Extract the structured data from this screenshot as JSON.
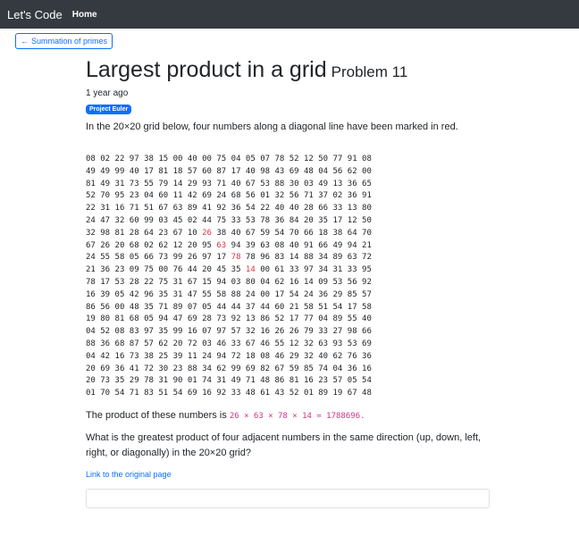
{
  "nav": {
    "brand": "Let's Code",
    "home": "Home"
  },
  "back_button": {
    "label": "Summation of primes",
    "icon": "arrow-left-icon"
  },
  "problem": {
    "title": "Largest product in a grid",
    "number": "Problem 11",
    "time_ago": "1 year ago",
    "badge": "Project Euler",
    "intro": "In the 20×20 grid below, four numbers along a diagonal line have been marked in red.",
    "grid_rows": [
      "08 02 22 97 38 15 00 40 00 75 04 05 07 78 52 12 50 77 91 08",
      "49 49 99 40 17 81 18 57 60 87 17 40 98 43 69 48 04 56 62 00",
      "81 49 31 73 55 79 14 29 93 71 40 67 53 88 30 03 49 13 36 65",
      "52 70 95 23 04 60 11 42 69 24 68 56 01 32 56 71 37 02 36 91",
      "22 31 16 71 51 67 63 89 41 92 36 54 22 40 40 28 66 33 13 80",
      "24 47 32 60 99 03 45 02 44 75 33 53 78 36 84 20 35 17 12 50",
      "32 98 81 28 64 23 67 10 26 38 40 67 59 54 70 66 18 38 64 70",
      "67 26 20 68 02 62 12 20 95 63 94 39 63 08 40 91 66 49 94 21",
      "24 55 58 05 66 73 99 26 97 17 78 78 96 83 14 88 34 89 63 72",
      "21 36 23 09 75 00 76 44 20 45 35 14 00 61 33 97 34 31 33 95",
      "78 17 53 28 22 75 31 67 15 94 03 80 04 62 16 14 09 53 56 92",
      "16 39 05 42 96 35 31 47 55 58 88 24 00 17 54 24 36 29 85 57",
      "86 56 00 48 35 71 89 07 05 44 44 37 44 60 21 58 51 54 17 58",
      "19 80 81 68 05 94 47 69 28 73 92 13 86 52 17 77 04 89 55 40",
      "04 52 08 83 97 35 99 16 07 97 57 32 16 26 26 79 33 27 98 66",
      "88 36 68 87 57 62 20 72 03 46 33 67 46 55 12 32 63 93 53 69",
      "04 42 16 73 38 25 39 11 24 94 72 18 08 46 29 32 40 62 76 36",
      "20 69 36 41 72 30 23 88 34 62 99 69 82 67 59 85 74 04 36 16",
      "20 73 35 29 78 31 90 01 74 31 49 71 48 86 81 16 23 57 05 54",
      "01 70 54 71 83 51 54 69 16 92 33 48 61 43 52 01 89 19 67 48"
    ],
    "highlighted_cells": [
      [
        6,
        8
      ],
      [
        7,
        9
      ],
      [
        8,
        10
      ],
      [
        9,
        11
      ]
    ],
    "product_prefix": "The product of these numbers is ",
    "product_code": "26 × 63 × 78 × 14 = 1788696.",
    "question": "What is the greatest product of four adjacent numbers in the same direction (up, down, left, right, or diagonally) in the 20×20 grid?",
    "link_label": "Link to the original page"
  },
  "colors": {
    "navbar_bg": "#343a40",
    "primary": "#0d6efd",
    "highlight": "#dc3545",
    "code": "#d63384"
  }
}
